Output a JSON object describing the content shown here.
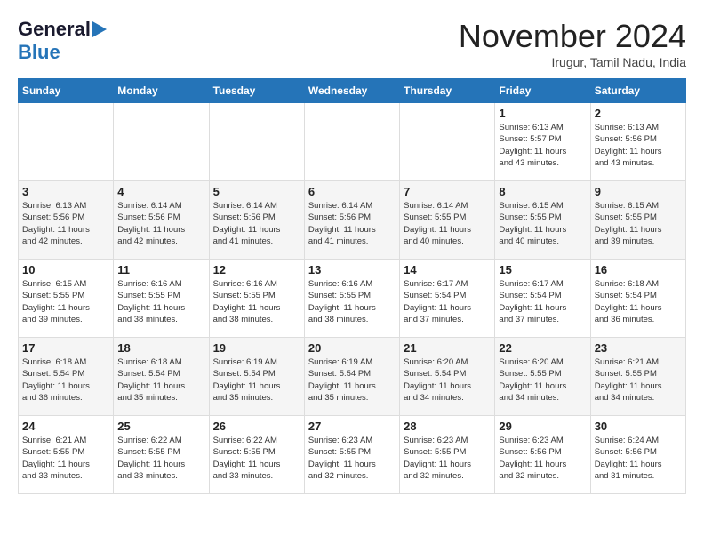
{
  "header": {
    "logo_general": "General",
    "logo_blue": "Blue",
    "month_title": "November 2024",
    "location": "Irugur, Tamil Nadu, India"
  },
  "calendar": {
    "days_of_week": [
      "Sunday",
      "Monday",
      "Tuesday",
      "Wednesday",
      "Thursday",
      "Friday",
      "Saturday"
    ],
    "weeks": [
      [
        {
          "day": "",
          "info": ""
        },
        {
          "day": "",
          "info": ""
        },
        {
          "day": "",
          "info": ""
        },
        {
          "day": "",
          "info": ""
        },
        {
          "day": "",
          "info": ""
        },
        {
          "day": "1",
          "info": "Sunrise: 6:13 AM\nSunset: 5:57 PM\nDaylight: 11 hours\nand 43 minutes."
        },
        {
          "day": "2",
          "info": "Sunrise: 6:13 AM\nSunset: 5:56 PM\nDaylight: 11 hours\nand 43 minutes."
        }
      ],
      [
        {
          "day": "3",
          "info": "Sunrise: 6:13 AM\nSunset: 5:56 PM\nDaylight: 11 hours\nand 42 minutes."
        },
        {
          "day": "4",
          "info": "Sunrise: 6:14 AM\nSunset: 5:56 PM\nDaylight: 11 hours\nand 42 minutes."
        },
        {
          "day": "5",
          "info": "Sunrise: 6:14 AM\nSunset: 5:56 PM\nDaylight: 11 hours\nand 41 minutes."
        },
        {
          "day": "6",
          "info": "Sunrise: 6:14 AM\nSunset: 5:56 PM\nDaylight: 11 hours\nand 41 minutes."
        },
        {
          "day": "7",
          "info": "Sunrise: 6:14 AM\nSunset: 5:55 PM\nDaylight: 11 hours\nand 40 minutes."
        },
        {
          "day": "8",
          "info": "Sunrise: 6:15 AM\nSunset: 5:55 PM\nDaylight: 11 hours\nand 40 minutes."
        },
        {
          "day": "9",
          "info": "Sunrise: 6:15 AM\nSunset: 5:55 PM\nDaylight: 11 hours\nand 39 minutes."
        }
      ],
      [
        {
          "day": "10",
          "info": "Sunrise: 6:15 AM\nSunset: 5:55 PM\nDaylight: 11 hours\nand 39 minutes."
        },
        {
          "day": "11",
          "info": "Sunrise: 6:16 AM\nSunset: 5:55 PM\nDaylight: 11 hours\nand 38 minutes."
        },
        {
          "day": "12",
          "info": "Sunrise: 6:16 AM\nSunset: 5:55 PM\nDaylight: 11 hours\nand 38 minutes."
        },
        {
          "day": "13",
          "info": "Sunrise: 6:16 AM\nSunset: 5:55 PM\nDaylight: 11 hours\nand 38 minutes."
        },
        {
          "day": "14",
          "info": "Sunrise: 6:17 AM\nSunset: 5:54 PM\nDaylight: 11 hours\nand 37 minutes."
        },
        {
          "day": "15",
          "info": "Sunrise: 6:17 AM\nSunset: 5:54 PM\nDaylight: 11 hours\nand 37 minutes."
        },
        {
          "day": "16",
          "info": "Sunrise: 6:18 AM\nSunset: 5:54 PM\nDaylight: 11 hours\nand 36 minutes."
        }
      ],
      [
        {
          "day": "17",
          "info": "Sunrise: 6:18 AM\nSunset: 5:54 PM\nDaylight: 11 hours\nand 36 minutes."
        },
        {
          "day": "18",
          "info": "Sunrise: 6:18 AM\nSunset: 5:54 PM\nDaylight: 11 hours\nand 35 minutes."
        },
        {
          "day": "19",
          "info": "Sunrise: 6:19 AM\nSunset: 5:54 PM\nDaylight: 11 hours\nand 35 minutes."
        },
        {
          "day": "20",
          "info": "Sunrise: 6:19 AM\nSunset: 5:54 PM\nDaylight: 11 hours\nand 35 minutes."
        },
        {
          "day": "21",
          "info": "Sunrise: 6:20 AM\nSunset: 5:54 PM\nDaylight: 11 hours\nand 34 minutes."
        },
        {
          "day": "22",
          "info": "Sunrise: 6:20 AM\nSunset: 5:55 PM\nDaylight: 11 hours\nand 34 minutes."
        },
        {
          "day": "23",
          "info": "Sunrise: 6:21 AM\nSunset: 5:55 PM\nDaylight: 11 hours\nand 34 minutes."
        }
      ],
      [
        {
          "day": "24",
          "info": "Sunrise: 6:21 AM\nSunset: 5:55 PM\nDaylight: 11 hours\nand 33 minutes."
        },
        {
          "day": "25",
          "info": "Sunrise: 6:22 AM\nSunset: 5:55 PM\nDaylight: 11 hours\nand 33 minutes."
        },
        {
          "day": "26",
          "info": "Sunrise: 6:22 AM\nSunset: 5:55 PM\nDaylight: 11 hours\nand 33 minutes."
        },
        {
          "day": "27",
          "info": "Sunrise: 6:23 AM\nSunset: 5:55 PM\nDaylight: 11 hours\nand 32 minutes."
        },
        {
          "day": "28",
          "info": "Sunrise: 6:23 AM\nSunset: 5:55 PM\nDaylight: 11 hours\nand 32 minutes."
        },
        {
          "day": "29",
          "info": "Sunrise: 6:23 AM\nSunset: 5:56 PM\nDaylight: 11 hours\nand 32 minutes."
        },
        {
          "day": "30",
          "info": "Sunrise: 6:24 AM\nSunset: 5:56 PM\nDaylight: 11 hours\nand 31 minutes."
        }
      ]
    ]
  }
}
